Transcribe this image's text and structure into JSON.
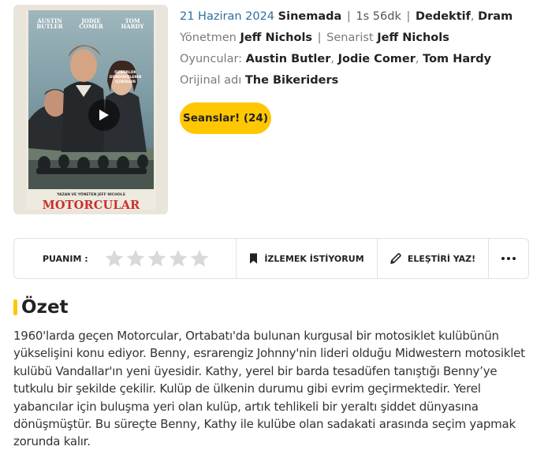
{
  "poster": {
    "actor_names": [
      "AUSTIN\nBUTLER",
      "JODIE\nCOMER",
      "TOM\nHARDY"
    ],
    "tagline": "ÖZGÜRLÜK\nDÜNDÜKÜLERİN\nİÇİNDEDİR",
    "credit": "YAZAN VE YÖNETEN JEFF NICHOLS",
    "title": "MOTORCULAR",
    "play_icon": "play-icon"
  },
  "meta": {
    "release_date": "21 Haziran 2024",
    "status": "Sinemada",
    "duration": "1s 56dk",
    "genres": [
      "Dedektif",
      "Dram"
    ]
  },
  "crew": {
    "director_label": "Yönetmen",
    "director": "Jeff Nichols",
    "writer_label": "Senarist",
    "writer": "Jeff Nichols"
  },
  "cast": {
    "label": "Oyuncular:",
    "actors": [
      "Austin Butler",
      "Jodie Comer",
      "Tom Hardy"
    ]
  },
  "original": {
    "label": "Orijinal adı",
    "title": "The Bikeriders"
  },
  "sessions_button": "Seanslar! (24)",
  "action_bar": {
    "rating_label": "PUANIM :",
    "star_count": 5,
    "watchlist_label": "İZLEMEK İSTİYORUM",
    "watchlist_icon": "bookmark-icon",
    "critique_label": "ELEŞTİRİ YAZ!",
    "critique_icon": "pencil-icon",
    "more_icon": "more-dots-icon"
  },
  "summary": {
    "title": "Özet",
    "text": "1960'larda geçen Motorcular, Ortabatı'da bulunan kurgusal bir motosiklet kulübünün yükselişini konu ediyor. Benny, esrarengiz Johnny'nin lideri olduğu Midwestern motosiklet kulübü Vandallar'ın yeni üyesidir. Kathy, yerel bir barda tesadüfen tanıştığı Benny’ye tutkulu bir şekilde çekilir. Kulüp de ülkenin durumu gibi evrim geçirmektedir. Yerel yabancılar için buluşma yeri olan kulüp, artık tehlikeli bir yeraltı şiddet dünyasına dönüşmüştür. Bu süreçte Benny, Kathy ile kulübe olan sadakati arasında seçim yapmak zorunda kalır."
  },
  "colors": {
    "accent": "#ffc700",
    "date_blue": "#2f6e9e",
    "poster_title_red": "#c9302c"
  }
}
